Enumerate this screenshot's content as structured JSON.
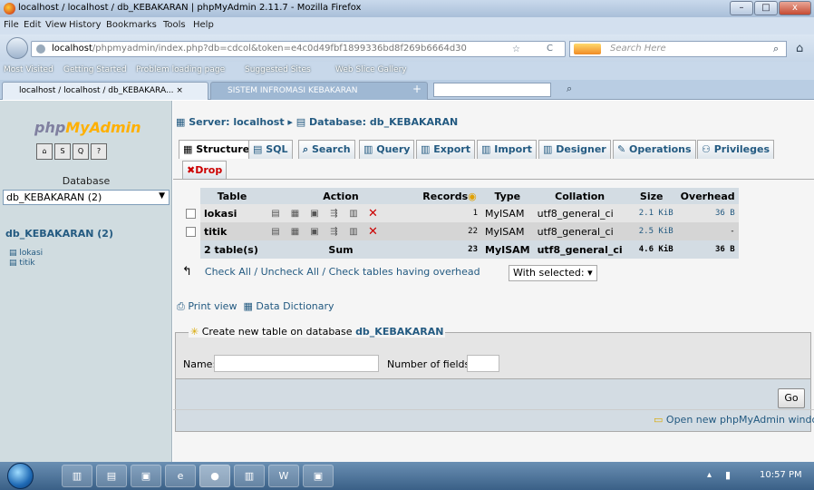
{
  "window": {
    "title": "localhost / localhost / db_KEBAKARAN | phpMyAdmin 2.11.7 - Mozilla Firefox",
    "min": "–",
    "max": "□",
    "close": "x"
  },
  "menu": [
    "File",
    "Edit",
    "View",
    "History",
    "Bookmarks",
    "Tools",
    "Help"
  ],
  "nav": {
    "url_host": "localhost",
    "url_rest": "/phpmyadmin/index.php?db=cdcol&token=e4c0d49fbf1899336bd8f269b6664d30",
    "search_placeholder": "Search Here"
  },
  "bookmarks": [
    "Most Visited",
    "Getting Started",
    "Problem loading page",
    "Suggested Sites",
    "Web Slice Gallery"
  ],
  "tabs": [
    "localhost / localhost / db_KEBAKARA...",
    "SISTEM INFROMASI KEBAKARAN"
  ],
  "left": {
    "logo_a": "php",
    "logo_b": "MyAdmin",
    "db_label": "Database",
    "db_selected": "db_KEBAKARAN (2)",
    "db_link": "db_KEBAKARAN",
    "db_count": "(2)",
    "tables": [
      "lokasi",
      "titik"
    ]
  },
  "crumb": {
    "server": "Server: localhost",
    "sep": "▸",
    "database": "Database: db_KEBAKARAN"
  },
  "main_tabs": [
    "Structure",
    "SQL",
    "Search",
    "Query",
    "Export",
    "Import",
    "Designer",
    "Operations",
    "Privileges"
  ],
  "drop": "Drop",
  "table": {
    "headers": [
      "Table",
      "Action",
      "Records",
      "Type",
      "Collation",
      "Size",
      "Overhead"
    ],
    "rows": [
      {
        "name": "lokasi",
        "records": "1",
        "type": "MyISAM",
        "collation": "utf8_general_ci",
        "size": "2.1 KiB",
        "overhead": "36 B"
      },
      {
        "name": "titik",
        "records": "22",
        "type": "MyISAM",
        "collation": "utf8_general_ci",
        "size": "2.5 KiB",
        "overhead": "-"
      }
    ],
    "total": {
      "name": "2 table(s)",
      "action": "Sum",
      "records": "23",
      "type": "MyISAM",
      "collation": "utf8_general_ci",
      "size": "4.6 KiB",
      "overhead": "36 B"
    }
  },
  "check_line": "Check All / Uncheck All / Check tables having overhead",
  "with_selected": "With selected:",
  "print_view": "Print view",
  "data_dictionary": "Data Dictionary",
  "create": {
    "legend": "Create new table on database",
    "db": "db_KEBAKARAN",
    "name_label": "Name:",
    "fields_label": "Number of fields:",
    "go": "Go"
  },
  "open_window": "Open new phpMyAdmin window",
  "clock": "10:57 PM"
}
